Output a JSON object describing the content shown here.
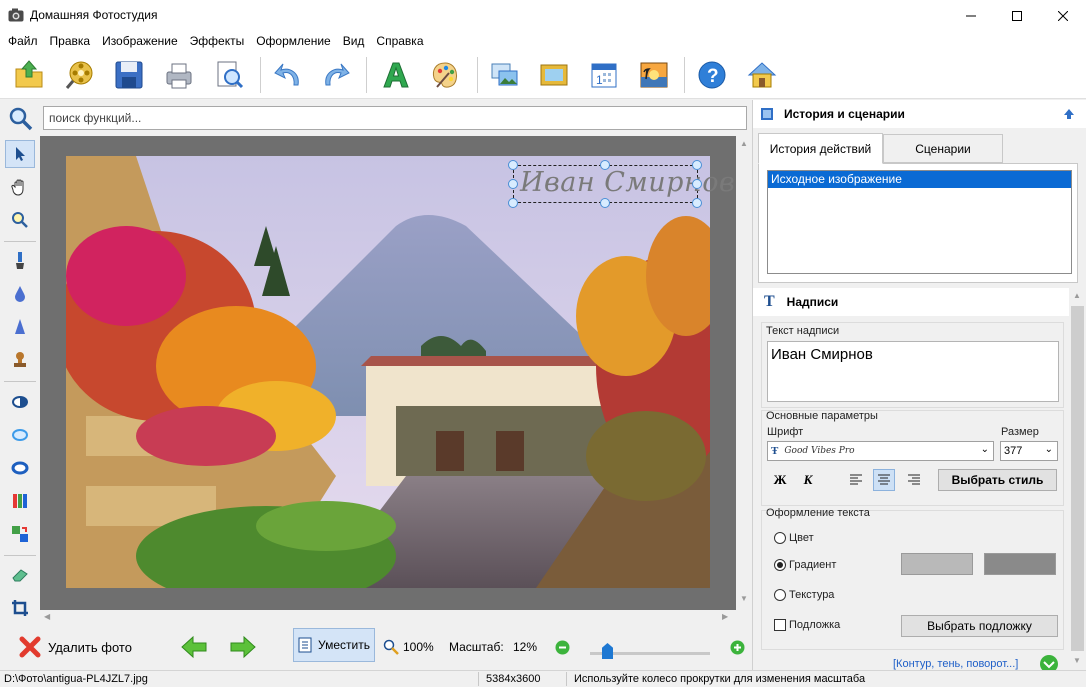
{
  "window": {
    "title": "Домашняя Фотостудия"
  },
  "menu": [
    "Файл",
    "Правка",
    "Изображение",
    "Эффекты",
    "Оформление",
    "Вид",
    "Справка"
  ],
  "search": {
    "placeholder": "поиск функций..."
  },
  "canvas": {
    "signature_text": "Иван Смирнов"
  },
  "bottom": {
    "delete_label": "Удалить фото",
    "fit_label": "Уместить",
    "zoom100_label": "100%",
    "scale_label": "Масштаб:",
    "scale_value": "12%"
  },
  "status": {
    "path": "D:\\Фото\\antigua-PL4JZL7.jpg",
    "dimensions": "5384x3600",
    "hint": "Используйте колесо прокрутки для изменения масштаба"
  },
  "right_panel": {
    "header": "История и сценарии",
    "tabs": [
      "История действий",
      "Сценарии"
    ],
    "history_items": [
      "Исходное изображение"
    ],
    "labels_header": "Надписи",
    "text_group_label": "Текст надписи",
    "text_value": "Иван Смирнов",
    "params_label": "Основные параметры",
    "font_label": "Шрифт",
    "font_value": "Good Vibes Pro",
    "size_label": "Размер",
    "size_value": "377",
    "bold_label": "Ж",
    "italic_label": "К",
    "choose_style_label": "Выбрать стиль",
    "decor_label": "Оформление текста",
    "color_label": "Цвет",
    "gradient_label": "Градиент",
    "texture_label": "Текстура",
    "backing_label": "Подложка",
    "choose_backing_label": "Выбрать подложку",
    "more_link": "[Контур, тень, поворот...]",
    "gradient_color_1": "#b9b9b9",
    "gradient_color_2": "#8a8a8a"
  }
}
